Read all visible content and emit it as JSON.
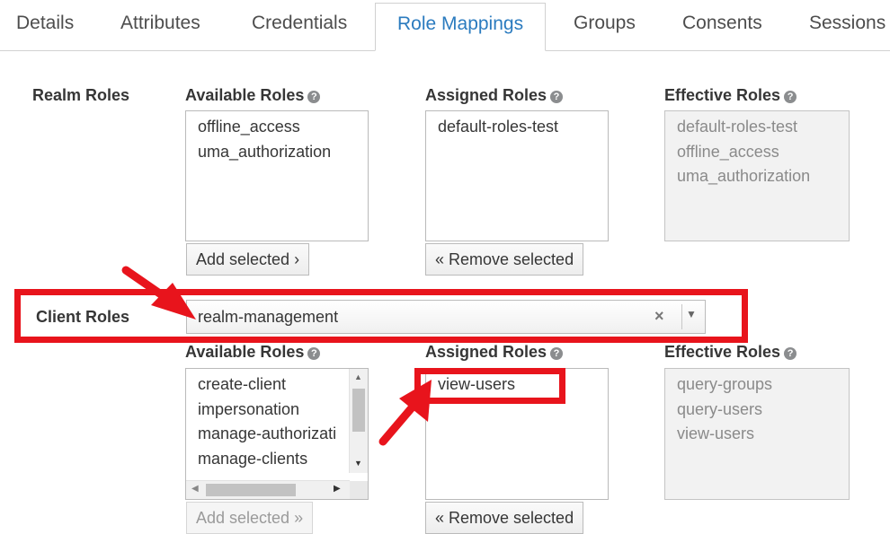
{
  "tabs": [
    {
      "label": "Details"
    },
    {
      "label": "Attributes"
    },
    {
      "label": "Credentials"
    },
    {
      "label": "Role Mappings",
      "active": true
    },
    {
      "label": "Groups"
    },
    {
      "label": "Consents"
    },
    {
      "label": "Sessions"
    }
  ],
  "realm_roles": {
    "label": "Realm Roles",
    "available": {
      "label": "Available Roles",
      "items": [
        "offline_access",
        "uma_authorization"
      ],
      "button": "Add selected ›"
    },
    "assigned": {
      "label": "Assigned Roles",
      "items": [
        "default-roles-test"
      ],
      "button": "« Remove selected"
    },
    "effective": {
      "label": "Effective Roles",
      "items": [
        "default-roles-test",
        "offline_access",
        "uma_authorization"
      ]
    }
  },
  "client_roles": {
    "label": "Client Roles",
    "select": {
      "value": "realm-management",
      "clear_glyph": "×",
      "arrow_glyph": "▼"
    },
    "available": {
      "label": "Available Roles",
      "items": [
        "create-client",
        "impersonation",
        "manage-authorizati",
        "manage-clients"
      ],
      "button": "Add selected »"
    },
    "assigned": {
      "label": "Assigned Roles",
      "items": [
        "view-users"
      ],
      "button": "« Remove selected"
    },
    "effective": {
      "label": "Effective Roles",
      "items": [
        "query-groups",
        "query-users",
        "view-users"
      ]
    }
  },
  "icons": {
    "help": "question-circle-icon",
    "help_glyph": "?"
  },
  "colors": {
    "annotation_red": "#e8141c",
    "active_tab": "#2b7bbf"
  }
}
